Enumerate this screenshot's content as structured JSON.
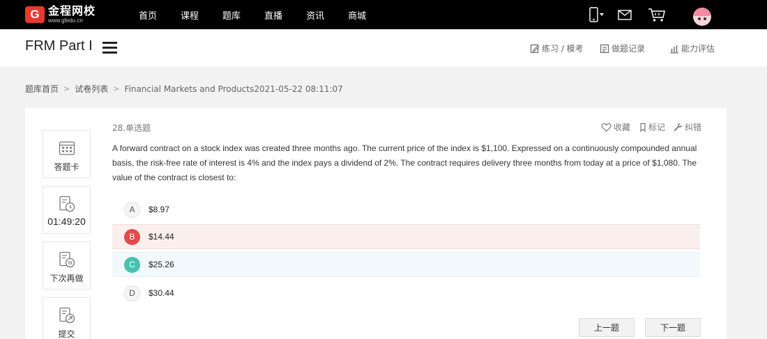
{
  "brand": {
    "mark": "G",
    "name": "金程网校",
    "domain": "www.gfedu.cn",
    "accent": "#e8382f"
  },
  "nav": {
    "items": [
      "首页",
      "课程",
      "题库",
      "直播",
      "资讯",
      "商城"
    ]
  },
  "top_icons": [
    "mobile-icon",
    "mail-icon",
    "cart-icon",
    "user-avatar"
  ],
  "subheader": {
    "title": "FRM Part I",
    "links": {
      "practice": "练习 / 模考",
      "records": "做题记录",
      "assessment": "能力评估"
    }
  },
  "breadcrumb": {
    "home": "题库首页",
    "list": "试卷列表",
    "current": "Financial Markets and Products2021-05-22 08:11:07"
  },
  "sidebar": {
    "answer_card": "答题卡",
    "timer": "01:49:20",
    "later": "下次再做",
    "submit": "提交"
  },
  "question": {
    "number": "28.单选题",
    "tools": {
      "favorite": "收藏",
      "mark": "标记",
      "report": "纠错"
    },
    "text": "A forward contract on a stock index was created three months ago. The current price of the index is $1,100. Expressed on a continuously compounded annual basis, the risk-free rate of interest is 4% and the index pays a dividend of 2%. The contract requires delivery three months from today at a price of $1,080. The value of the contract is closest to:",
    "options": [
      {
        "letter": "A",
        "value": "$8.97",
        "state": "normal"
      },
      {
        "letter": "B",
        "value": "$14.44",
        "state": "wrong"
      },
      {
        "letter": "C",
        "value": "$25.26",
        "state": "correct"
      },
      {
        "letter": "D",
        "value": "$30.44",
        "state": "normal"
      }
    ],
    "colors": {
      "wrong": "#e04b4b",
      "correct": "#47c1b0"
    }
  },
  "pager": {
    "prev": "上一题",
    "next": "下一题"
  }
}
